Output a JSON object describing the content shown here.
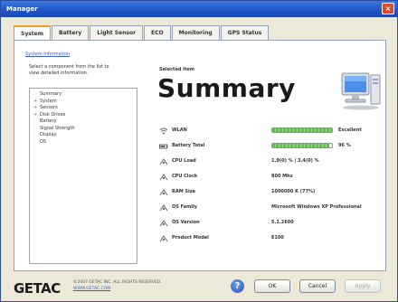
{
  "window": {
    "title": "Manager",
    "close_glyph": "×"
  },
  "tabs": [
    "System",
    "Battery",
    "Light Sensor",
    "ECO",
    "Monitoring",
    "GPS Status"
  ],
  "left": {
    "section_link": "System Information",
    "instructions": "Select a component from the list to view detailed information.",
    "tree": [
      {
        "label": "Summary",
        "expander": "",
        "child": false
      },
      {
        "label": "System",
        "expander": "+",
        "child": false
      },
      {
        "label": "Sensors",
        "expander": "+",
        "child": false
      },
      {
        "label": "Disk Drives",
        "expander": "+",
        "child": false
      },
      {
        "label": "Battery",
        "expander": "",
        "child": true
      },
      {
        "label": "Signal Strength",
        "expander": "",
        "child": true
      },
      {
        "label": "Display",
        "expander": "",
        "child": true
      },
      {
        "label": "OS",
        "expander": "",
        "child": true
      }
    ]
  },
  "selected": {
    "label": "Selected Item",
    "title": "Summary"
  },
  "rows": [
    {
      "icon": "wifi-icon",
      "label": "WLAN",
      "type": "bar",
      "level": 1.0,
      "value": "Excellent"
    },
    {
      "icon": "battery-icon",
      "label": "Battery Total",
      "type": "bar",
      "level": 0.96,
      "value": "96 %"
    },
    {
      "icon": "cpu-icon",
      "label": "CPU Load",
      "type": "text",
      "value": "1.9(0) % | 3.4(0) %"
    },
    {
      "icon": "clock-icon",
      "label": "CPU Clock",
      "type": "text",
      "value": "800 Mhz"
    },
    {
      "icon": "memory-icon",
      "label": "RAM Size",
      "type": "text",
      "value": "1000000 K (77%)"
    },
    {
      "icon": "os-icon",
      "label": "OS Family",
      "type": "text",
      "value": "Microsoft Windows XP Professional"
    },
    {
      "icon": "version-icon",
      "label": "OS Version",
      "type": "text",
      "value": "5.1.2600"
    },
    {
      "icon": "product-icon",
      "label": "Product Model",
      "type": "text",
      "value": "E100"
    }
  ],
  "footer": {
    "logo": "GETAC",
    "copyright": "©2007 GETAC INC. ALL RIGHTS RESERVED.",
    "weblink": "WWW.GETAC.COM",
    "help_glyph": "?",
    "ok_label": "OK",
    "cancel_label": "Cancel",
    "apply_label": "Apply"
  },
  "colors": {
    "accent": "#1f55c6",
    "bar_fill": "#5fbf4f",
    "link": "#3b5fc4"
  }
}
